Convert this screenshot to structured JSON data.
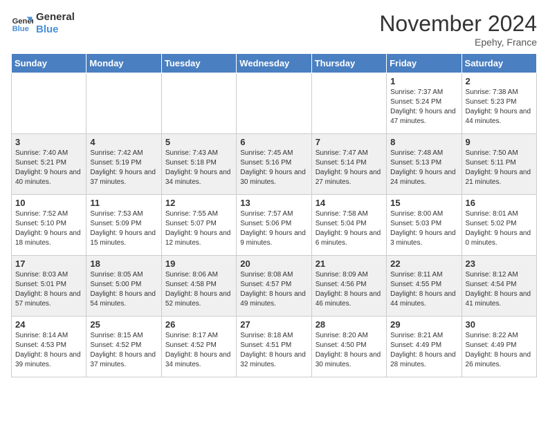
{
  "logo": {
    "line1": "General",
    "line2": "Blue"
  },
  "title": "November 2024",
  "location": "Epehy, France",
  "days_of_week": [
    "Sunday",
    "Monday",
    "Tuesday",
    "Wednesday",
    "Thursday",
    "Friday",
    "Saturday"
  ],
  "weeks": [
    [
      {
        "day": "",
        "info": ""
      },
      {
        "day": "",
        "info": ""
      },
      {
        "day": "",
        "info": ""
      },
      {
        "day": "",
        "info": ""
      },
      {
        "day": "",
        "info": ""
      },
      {
        "day": "1",
        "info": "Sunrise: 7:37 AM\nSunset: 5:24 PM\nDaylight: 9 hours and 47 minutes."
      },
      {
        "day": "2",
        "info": "Sunrise: 7:38 AM\nSunset: 5:23 PM\nDaylight: 9 hours and 44 minutes."
      }
    ],
    [
      {
        "day": "3",
        "info": "Sunrise: 7:40 AM\nSunset: 5:21 PM\nDaylight: 9 hours and 40 minutes."
      },
      {
        "day": "4",
        "info": "Sunrise: 7:42 AM\nSunset: 5:19 PM\nDaylight: 9 hours and 37 minutes."
      },
      {
        "day": "5",
        "info": "Sunrise: 7:43 AM\nSunset: 5:18 PM\nDaylight: 9 hours and 34 minutes."
      },
      {
        "day": "6",
        "info": "Sunrise: 7:45 AM\nSunset: 5:16 PM\nDaylight: 9 hours and 30 minutes."
      },
      {
        "day": "7",
        "info": "Sunrise: 7:47 AM\nSunset: 5:14 PM\nDaylight: 9 hours and 27 minutes."
      },
      {
        "day": "8",
        "info": "Sunrise: 7:48 AM\nSunset: 5:13 PM\nDaylight: 9 hours and 24 minutes."
      },
      {
        "day": "9",
        "info": "Sunrise: 7:50 AM\nSunset: 5:11 PM\nDaylight: 9 hours and 21 minutes."
      }
    ],
    [
      {
        "day": "10",
        "info": "Sunrise: 7:52 AM\nSunset: 5:10 PM\nDaylight: 9 hours and 18 minutes."
      },
      {
        "day": "11",
        "info": "Sunrise: 7:53 AM\nSunset: 5:09 PM\nDaylight: 9 hours and 15 minutes."
      },
      {
        "day": "12",
        "info": "Sunrise: 7:55 AM\nSunset: 5:07 PM\nDaylight: 9 hours and 12 minutes."
      },
      {
        "day": "13",
        "info": "Sunrise: 7:57 AM\nSunset: 5:06 PM\nDaylight: 9 hours and 9 minutes."
      },
      {
        "day": "14",
        "info": "Sunrise: 7:58 AM\nSunset: 5:04 PM\nDaylight: 9 hours and 6 minutes."
      },
      {
        "day": "15",
        "info": "Sunrise: 8:00 AM\nSunset: 5:03 PM\nDaylight: 9 hours and 3 minutes."
      },
      {
        "day": "16",
        "info": "Sunrise: 8:01 AM\nSunset: 5:02 PM\nDaylight: 9 hours and 0 minutes."
      }
    ],
    [
      {
        "day": "17",
        "info": "Sunrise: 8:03 AM\nSunset: 5:01 PM\nDaylight: 8 hours and 57 minutes."
      },
      {
        "day": "18",
        "info": "Sunrise: 8:05 AM\nSunset: 5:00 PM\nDaylight: 8 hours and 54 minutes."
      },
      {
        "day": "19",
        "info": "Sunrise: 8:06 AM\nSunset: 4:58 PM\nDaylight: 8 hours and 52 minutes."
      },
      {
        "day": "20",
        "info": "Sunrise: 8:08 AM\nSunset: 4:57 PM\nDaylight: 8 hours and 49 minutes."
      },
      {
        "day": "21",
        "info": "Sunrise: 8:09 AM\nSunset: 4:56 PM\nDaylight: 8 hours and 46 minutes."
      },
      {
        "day": "22",
        "info": "Sunrise: 8:11 AM\nSunset: 4:55 PM\nDaylight: 8 hours and 44 minutes."
      },
      {
        "day": "23",
        "info": "Sunrise: 8:12 AM\nSunset: 4:54 PM\nDaylight: 8 hours and 41 minutes."
      }
    ],
    [
      {
        "day": "24",
        "info": "Sunrise: 8:14 AM\nSunset: 4:53 PM\nDaylight: 8 hours and 39 minutes."
      },
      {
        "day": "25",
        "info": "Sunrise: 8:15 AM\nSunset: 4:52 PM\nDaylight: 8 hours and 37 minutes."
      },
      {
        "day": "26",
        "info": "Sunrise: 8:17 AM\nSunset: 4:52 PM\nDaylight: 8 hours and 34 minutes."
      },
      {
        "day": "27",
        "info": "Sunrise: 8:18 AM\nSunset: 4:51 PM\nDaylight: 8 hours and 32 minutes."
      },
      {
        "day": "28",
        "info": "Sunrise: 8:20 AM\nSunset: 4:50 PM\nDaylight: 8 hours and 30 minutes."
      },
      {
        "day": "29",
        "info": "Sunrise: 8:21 AM\nSunset: 4:49 PM\nDaylight: 8 hours and 28 minutes."
      },
      {
        "day": "30",
        "info": "Sunrise: 8:22 AM\nSunset: 4:49 PM\nDaylight: 8 hours and 26 minutes."
      }
    ]
  ]
}
